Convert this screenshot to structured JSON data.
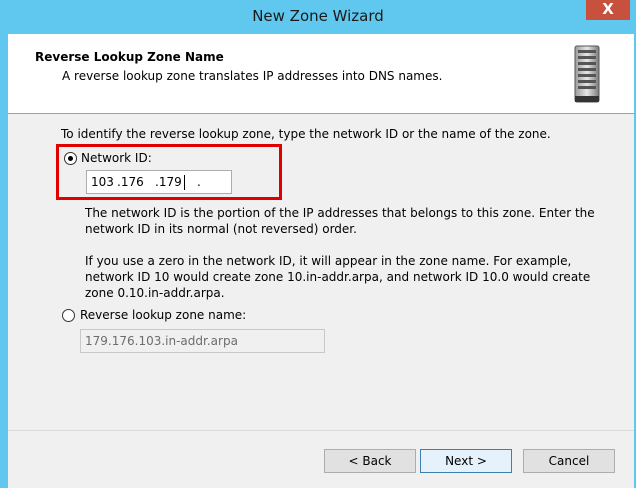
{
  "window": {
    "title": "New Zone Wizard",
    "close_label": "X"
  },
  "header": {
    "title": "Reverse Lookup Zone Name",
    "subtitle": "A reverse lookup zone translates IP addresses into DNS names.",
    "icon": "server-icon"
  },
  "content": {
    "instruction": "To identify the reverse lookup zone, type the network ID or the name of the zone.",
    "network_id": {
      "label": "Network ID:",
      "selected": true,
      "octets": [
        "103",
        ".176",
        ".179",
        "."
      ],
      "description": "The network ID is the portion of the IP addresses that belongs to this zone. Enter the network ID in its normal (not reversed) order.",
      "zero_note_line1": "If you use a zero in the network ID, it will appear in the zone name. For example,",
      "zero_note_line2": "network ID 10 would create zone 10.in-addr.arpa, and network ID 10.0 would create",
      "zero_note_line3": "zone 0.10.in-addr.arpa."
    },
    "zone_name": {
      "label": "Reverse lookup zone name:",
      "selected": false,
      "value": "179.176.103.in-addr.arpa"
    }
  },
  "buttons": {
    "back": "< Back",
    "next": "Next >",
    "cancel": "Cancel"
  },
  "colors": {
    "titlebar": "#60c8ee",
    "close": "#c7513c",
    "highlight": "#e00000"
  }
}
